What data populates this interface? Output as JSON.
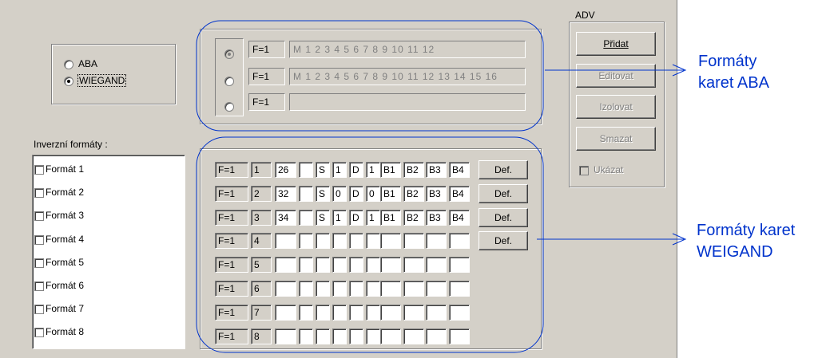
{
  "card_type": {
    "options": [
      {
        "label": "ABA",
        "selected": false
      },
      {
        "label": "WIEGAND",
        "selected": true
      }
    ]
  },
  "aba_formats": [
    {
      "selected": true,
      "prefix": "F=1",
      "value": "M 1 2 3 4 5 6 7 8 9 10 11 12"
    },
    {
      "selected": false,
      "prefix": "F=1",
      "value": "M 1 2 3 4 5 6 7 8 9 10 11 12 13 14 15 16"
    },
    {
      "selected": false,
      "prefix": "F=1",
      "value": ""
    }
  ],
  "adv": {
    "title": "ADV",
    "buttons": [
      {
        "label": "Přidat",
        "enabled": true
      },
      {
        "label": "Editovat",
        "enabled": false
      },
      {
        "label": "Izolovat",
        "enabled": false
      },
      {
        "label": "Smazat",
        "enabled": false
      }
    ],
    "show_label": "Ukázat"
  },
  "inverse": {
    "title": "Inverzní formáty :",
    "items": [
      "Formát 1",
      "Formát 2",
      "Formát 3",
      "Formát 4",
      "Formát 5",
      "Formát 6",
      "Formát 7",
      "Formát 8"
    ]
  },
  "wiegand_rows": [
    {
      "prefix": "F=1",
      "num": "1",
      "cells": [
        "26",
        "",
        "S",
        "1",
        "D",
        "1",
        "B1",
        "B2",
        "B3",
        "B4"
      ],
      "def": "Def."
    },
    {
      "prefix": "F=1",
      "num": "2",
      "cells": [
        "32",
        "",
        "S",
        "0",
        "D",
        "0",
        "B1",
        "B2",
        "B3",
        "B4"
      ],
      "def": "Def."
    },
    {
      "prefix": "F=1",
      "num": "3",
      "cells": [
        "34",
        "",
        "S",
        "1",
        "D",
        "1",
        "B1",
        "B2",
        "B3",
        "B4"
      ],
      "def": "Def."
    },
    {
      "prefix": "F=1",
      "num": "4",
      "cells": [
        "",
        "",
        "",
        "",
        "",
        "",
        "",
        "",
        "",
        ""
      ],
      "def": "Def."
    },
    {
      "prefix": "F=1",
      "num": "5",
      "cells": [
        "",
        "",
        "",
        "",
        "",
        "",
        "",
        "",
        "",
        ""
      ],
      "def": null
    },
    {
      "prefix": "F=1",
      "num": "6",
      "cells": [
        "",
        "",
        "",
        "",
        "",
        "",
        "",
        "",
        "",
        ""
      ],
      "def": null
    },
    {
      "prefix": "F=1",
      "num": "7",
      "cells": [
        "",
        "",
        "",
        "",
        "",
        "",
        "",
        "",
        "",
        ""
      ],
      "def": null
    },
    {
      "prefix": "F=1",
      "num": "8",
      "cells": [
        "",
        "",
        "",
        "",
        "",
        "",
        "",
        "",
        "",
        ""
      ],
      "def": null
    }
  ],
  "annotations": {
    "aba_line1": "Formáty",
    "aba_line2": "karet ABA",
    "wiegand_line1": "Formáty karet",
    "wiegand_line2": "WEIGAND"
  },
  "colors": {
    "dialog_bg": "#d4d0c8",
    "annotation": "#0033cc"
  }
}
